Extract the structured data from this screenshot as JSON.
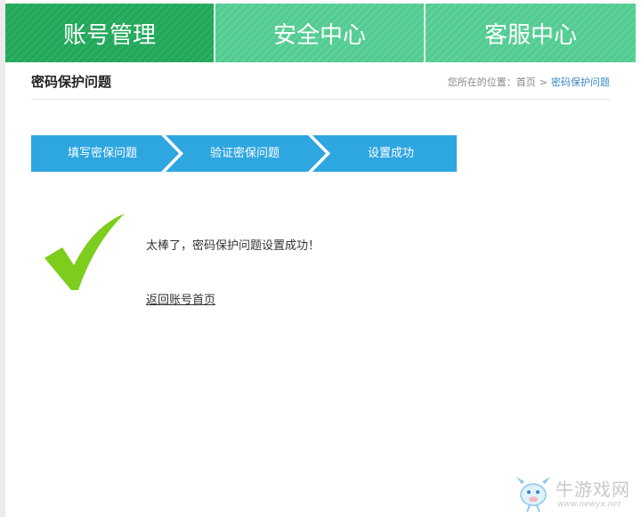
{
  "nav": {
    "tabs": [
      {
        "label": "账号管理",
        "active": true
      },
      {
        "label": "安全中心",
        "active": false
      },
      {
        "label": "客服中心",
        "active": false
      }
    ]
  },
  "page": {
    "title": "密码保护问题",
    "breadcrumb": {
      "prefix": "您所在的位置：",
      "home": "首页",
      "separator": ">",
      "current": "密码保护问题"
    }
  },
  "steps": [
    "填写密保问题",
    "验证密保问题",
    "设置成功"
  ],
  "result": {
    "message": "太棒了，密码保护问题设置成功！",
    "back_link": "返回账号首页"
  },
  "watermark": {
    "title": "牛游戏网",
    "url": "www.newyx.net"
  },
  "colors": {
    "tab_active": "#22a85a",
    "tab_inactive": "#52cc91",
    "step_bar": "#2ea6e0",
    "check": "#7ccd1c",
    "link": "#3a88c5"
  },
  "icons": {
    "check": "checkmark-icon",
    "mascot": "cow-mascot-icon"
  }
}
